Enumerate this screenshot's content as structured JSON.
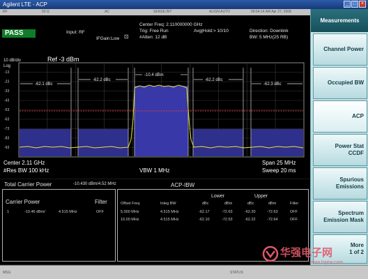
{
  "window": {
    "title": "Agilent LTE - ACP",
    "buttons": [
      "_",
      "□",
      "×"
    ]
  },
  "status_strip": {
    "items": [
      "RF",
      "50 Ω",
      "AC",
      "SENSE:INT",
      "ALIGN AUTO",
      "09:54:14 AM Apr 27, 2008"
    ]
  },
  "infobar": {
    "pass_label": "PASS",
    "input": "Input: RF",
    "if_gain": "IFGain:Low",
    "center_freq": "Center Freq: 2.110000000 GHz",
    "trig": "Trig: Free Run",
    "atten": "#Atten: 12 dB",
    "avg_hold": "Avg|Hold:> 10/10",
    "direction": "Direction: Downlink",
    "bw": "BW: 5 MHz(25 RB)"
  },
  "plot": {
    "scale": "10 dB/div",
    "ref": "Ref -3 dBm",
    "log": "Log",
    "y_ticks": [
      "-13",
      "-23",
      "-33",
      "-43",
      "-53",
      "-63",
      "-73",
      "-83",
      "-93"
    ],
    "labels": {
      "ch_center": "-10.4 dBm",
      "l2": "-62.1 dBc",
      "l1": "-62.2 dBc",
      "u1": "-62.2 dBc",
      "u2": "-62.3 dBc"
    },
    "center": "Center 2.11 GHz",
    "res_bw": "#Res BW 100 kHz",
    "vbw": "VBW 1 MHz",
    "span": "Span 25 MHz",
    "sweep": "Sweep 20 ms"
  },
  "results": {
    "total_carrier_power_label": "Total Carrier Power",
    "total_carrier_power_value": "-10.430 dBm/4.52 MHz",
    "acp_label": "ACP-IBW",
    "carrier_power_label": "Carrier Power",
    "filter_label": "Filter",
    "carrier_row": {
      "index": "1",
      "power": "-10.46 dBm/",
      "bw": "4.515 MHz",
      "filter": "OFF"
    },
    "lower_label": "Lower",
    "upper_label": "Upper",
    "columns": [
      "Offset Freq",
      "Integ BW",
      "dBc",
      "dBm",
      "dBc",
      "dBm",
      "Filter"
    ],
    "rows": [
      [
        "5.000 MHz",
        "4.515 MHz",
        "-62.17",
        "-72.63",
        "-62.20",
        "-72.63",
        "OFF"
      ],
      [
        "10.00 MHz",
        "4.515 MHz",
        "-62.10",
        "-72.53",
        "-62.22",
        "-72.64",
        "OFF"
      ]
    ]
  },
  "bottombar": {
    "msg": "MSG",
    "status": "STATUS"
  },
  "softkeys": {
    "title": "Measurements",
    "items": [
      {
        "line1": "Channel Power",
        "line2": ""
      },
      {
        "line1": "Occupied BW",
        "line2": ""
      },
      {
        "line1": "ACP",
        "line2": ""
      },
      {
        "line1": "Power Stat",
        "line2": "CCDF"
      },
      {
        "line1": "Spurious",
        "line2": "Emissions"
      },
      {
        "line1": "Spectrum",
        "line2": "Emission Mask"
      },
      {
        "line1": "More",
        "line2": "1 of 2"
      }
    ]
  },
  "watermark": {
    "cn": "华强电子网",
    "url": "www.hqew.com"
  }
}
